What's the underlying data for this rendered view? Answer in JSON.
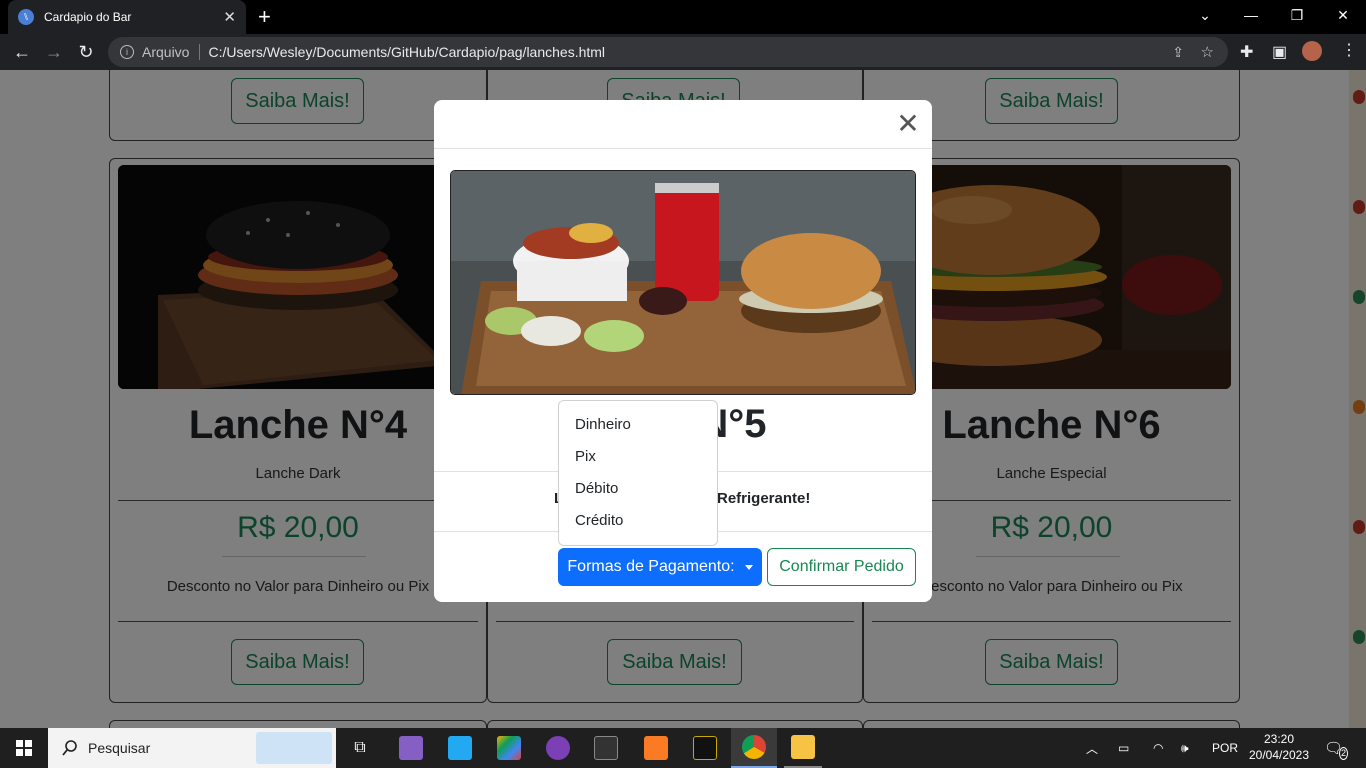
{
  "browser": {
    "tab_title": "Cardapio do Bar",
    "address_scheme": "Arquivo",
    "address_url": "C:/Users/Wesley/Documents/GitHub/Cardapio/pag/lanches.html"
  },
  "page": {
    "top_buttons": [
      "Saiba Mais!",
      "Saiba Mais!",
      "Saiba Mais!"
    ],
    "cards": [
      {
        "title": "Lanche N°4",
        "subtitle": "Lanche Dark",
        "price": "R$ 20,00",
        "description": "Desconto no Valor para Dinheiro ou Pix",
        "button": "Saiba Mais!"
      },
      {
        "title": "Lanche N°5",
        "subtitle": "",
        "price": "",
        "description": "",
        "button": "Saiba Mais!"
      },
      {
        "title": "Lanche N°6",
        "subtitle": "Lanche Especial",
        "price": "R$ 20,00",
        "description": "Desconto no Valor para Dinheiro ou Pix",
        "button": "Saiba Mais!"
      }
    ]
  },
  "modal": {
    "title": "N°5",
    "description_left": "L",
    "description_right": "Refrigerante!",
    "payment_button": "Formas de Pagamento:",
    "confirm_button": "Confirmar Pedido",
    "payment_options": [
      "Dinheiro",
      "Pix",
      "Débito",
      "Crédito"
    ]
  },
  "taskbar": {
    "search_placeholder": "Pesquisar",
    "language": "POR",
    "time": "23:20",
    "date": "20/04/2023",
    "notifications": "2"
  },
  "colors": {
    "accent_green": "#198754",
    "primary_blue": "#0d6efd"
  }
}
